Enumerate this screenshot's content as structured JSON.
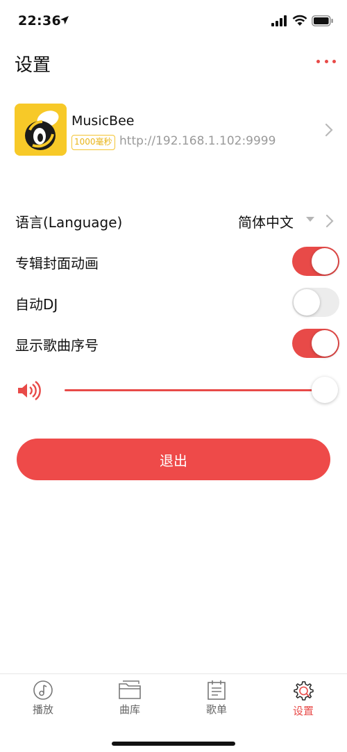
{
  "status_bar": {
    "time": "22:36"
  },
  "header": {
    "title": "设置"
  },
  "server": {
    "name": "MusicBee",
    "latency": "1000毫秒",
    "url": "http://192.168.1.102:9999"
  },
  "settings": {
    "language": {
      "label": "语言(Language)",
      "value": "简体中文"
    },
    "album_cover_animation": {
      "label": "专辑封面动画",
      "enabled": true
    },
    "auto_dj": {
      "label": "自动DJ",
      "enabled": false
    },
    "show_track_number": {
      "label": "显示歌曲序号",
      "enabled": true
    }
  },
  "volume": {
    "level": 1.0
  },
  "logout": {
    "label": "退出"
  },
  "tabs": [
    {
      "label": "播放",
      "icon": "music-note-icon",
      "active": false
    },
    {
      "label": "曲库",
      "icon": "folder-icon",
      "active": false
    },
    {
      "label": "歌单",
      "icon": "playlist-icon",
      "active": false
    },
    {
      "label": "设置",
      "icon": "gear-icon",
      "active": true
    }
  ],
  "colors": {
    "accent": "#e84a48",
    "badge": "#f4c430",
    "logo_bg": "#f7c928"
  }
}
